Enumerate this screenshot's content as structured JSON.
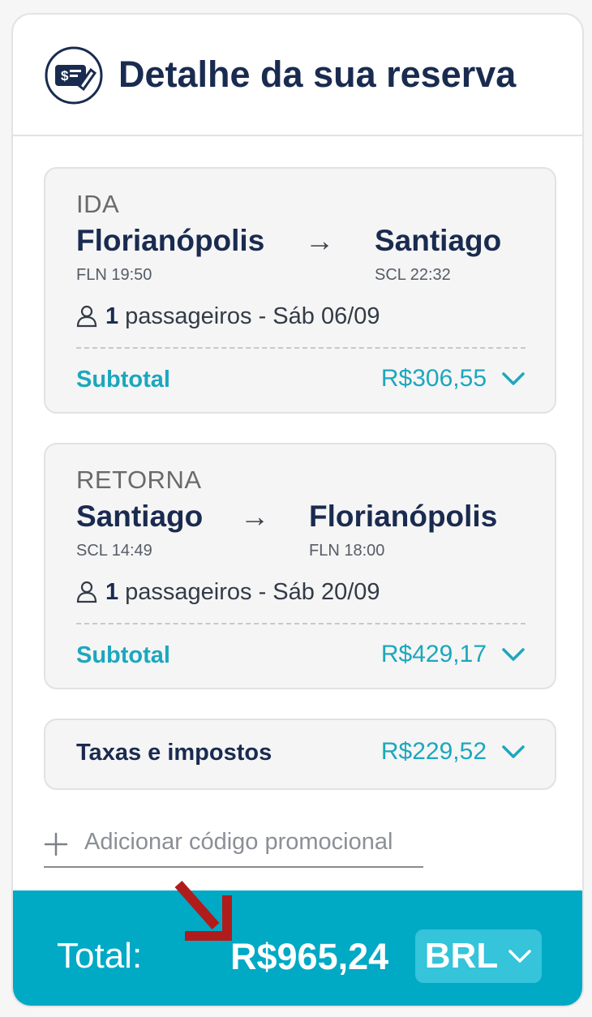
{
  "header": {
    "title": "Detalhe da sua reserva",
    "icon": "price-tag-icon"
  },
  "segments": [
    {
      "label": "IDA",
      "origin_city": "Florianópolis",
      "origin_code_time": "FLN 19:50",
      "destination_city": "Santiago",
      "destination_code_time": "SCL 22:32",
      "passenger_count": "1",
      "passenger_text": "passageiros - Sáb 06/09",
      "subtotal_label": "Subtotal",
      "subtotal_value": "R$306,55"
    },
    {
      "label": "RETORNA",
      "origin_city": "Santiago",
      "origin_code_time": "SCL 14:49",
      "destination_city": "Florianópolis",
      "destination_code_time": "FLN 18:00",
      "passenger_count": "1",
      "passenger_text": "passageiros - Sáb 20/09",
      "subtotal_label": "Subtotal",
      "subtotal_value": "R$429,17"
    }
  ],
  "taxes": {
    "label": "Taxas e impostos",
    "value": "R$229,52"
  },
  "promo": {
    "text": "Adicionar código promocional"
  },
  "total": {
    "label": "Total:",
    "value": "R$965,24",
    "currency": "BRL"
  },
  "colors": {
    "navy": "#1a2b50",
    "teal": "#1ca7be",
    "total_bar": "#00a9c4",
    "annotation_arrow": "#b01c1c"
  }
}
